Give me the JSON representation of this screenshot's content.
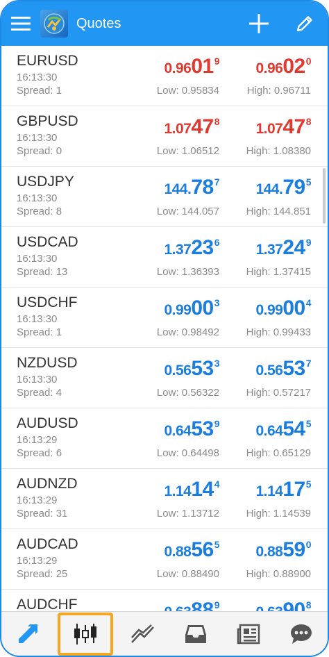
{
  "header": {
    "title": "Quotes",
    "icons": [
      "menu-icon",
      "app-logo",
      "plus-icon",
      "pencil-icon"
    ]
  },
  "colors": {
    "header": "#2196f3",
    "down": "#e0392f",
    "up": "#1a7de0",
    "highlight": "#f5a623"
  },
  "low_label": "Low: ",
  "high_label": "High: ",
  "quotes": [
    {
      "symbol": "EURUSD",
      "time": "16:13:30",
      "spread": "Spread: 1",
      "dir": "red",
      "bid": {
        "pre": "0.96",
        "big": "01",
        "sup": "9"
      },
      "ask": {
        "pre": "0.96",
        "big": "02",
        "sup": "0"
      },
      "low": "Low: 0.95834",
      "high": "High: 0.96711"
    },
    {
      "symbol": "GBPUSD",
      "time": "16:13:30",
      "spread": "Spread: 0",
      "dir": "red",
      "bid": {
        "pre": "1.07",
        "big": "47",
        "sup": "8"
      },
      "ask": {
        "pre": "1.07",
        "big": "47",
        "sup": "8"
      },
      "low": "Low: 1.06512",
      "high": "High: 1.08380"
    },
    {
      "symbol": "USDJPY",
      "time": "16:13:30",
      "spread": "Spread: 8",
      "dir": "blue",
      "bid": {
        "pre": "144.",
        "big": "78",
        "sup": "7"
      },
      "ask": {
        "pre": "144.",
        "big": "79",
        "sup": "5"
      },
      "low": "Low: 144.057",
      "high": "High: 144.851"
    },
    {
      "symbol": "USDCAD",
      "time": "16:13:30",
      "spread": "Spread: 13",
      "dir": "blue",
      "bid": {
        "pre": "1.37",
        "big": "23",
        "sup": "6"
      },
      "ask": {
        "pre": "1.37",
        "big": "24",
        "sup": "9"
      },
      "low": "Low: 1.36393",
      "high": "High: 1.37415"
    },
    {
      "symbol": "USDCHF",
      "time": "16:13:30",
      "spread": "Spread: 1",
      "dir": "blue",
      "bid": {
        "pre": "0.99",
        "big": "00",
        "sup": "3"
      },
      "ask": {
        "pre": "0.99",
        "big": "00",
        "sup": "4"
      },
      "low": "Low: 0.98492",
      "high": "High: 0.99433"
    },
    {
      "symbol": "NZDUSD",
      "time": "16:13:30",
      "spread": "Spread: 4",
      "dir": "blue",
      "bid": {
        "pre": "0.56",
        "big": "53",
        "sup": "3"
      },
      "ask": {
        "pre": "0.56",
        "big": "53",
        "sup": "7"
      },
      "low": "Low: 0.56322",
      "high": "High: 0.57217"
    },
    {
      "symbol": "AUDUSD",
      "time": "16:13:29",
      "spread": "Spread: 6",
      "dir": "blue",
      "bid": {
        "pre": "0.64",
        "big": "53",
        "sup": "9"
      },
      "ask": {
        "pre": "0.64",
        "big": "54",
        "sup": "5"
      },
      "low": "Low: 0.64498",
      "high": "High: 0.65129"
    },
    {
      "symbol": "AUDNZD",
      "time": "16:13:29",
      "spread": "Spread: 31",
      "dir": "blue",
      "bid": {
        "pre": "1.14",
        "big": "14",
        "sup": "4"
      },
      "ask": {
        "pre": "1.14",
        "big": "17",
        "sup": "5"
      },
      "low": "Low: 1.13712",
      "high": "High: 1.14539"
    },
    {
      "symbol": "AUDCAD",
      "time": "16:13:29",
      "spread": "Spread: 25",
      "dir": "blue",
      "bid": {
        "pre": "0.88",
        "big": "56",
        "sup": "5"
      },
      "ask": {
        "pre": "0.88",
        "big": "59",
        "sup": "0"
      },
      "low": "Low: 0.88490",
      "high": "High: 0.88900"
    },
    {
      "symbol": "AUDCHF",
      "time": "",
      "spread": "",
      "dir": "blue",
      "bid": {
        "pre": "0.63",
        "big": "88",
        "sup": "9"
      },
      "ask": {
        "pre": "0.63",
        "big": "90",
        "sup": "8"
      },
      "low": "",
      "high": ""
    }
  ],
  "bottom_nav": [
    {
      "name": "trade-arrow-icon",
      "active": false
    },
    {
      "name": "quotes-icon",
      "active": true
    },
    {
      "name": "chart-icon",
      "active": false
    },
    {
      "name": "inbox-icon",
      "active": false
    },
    {
      "name": "news-icon",
      "active": false
    },
    {
      "name": "chat-icon",
      "active": false
    }
  ]
}
